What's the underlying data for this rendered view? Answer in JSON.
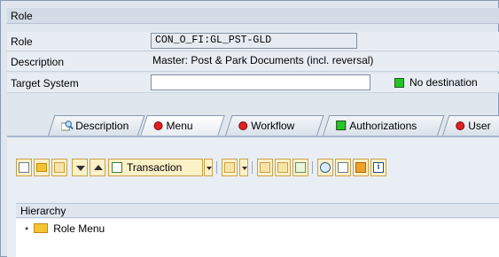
{
  "header": {
    "title": "Role"
  },
  "form": {
    "role": {
      "label": "Role",
      "value": "CON_O_FI:GL_PST-GLD"
    },
    "description": {
      "label": "Description",
      "value": "Master: Post & Park Documents (incl. reversal)"
    },
    "target_system": {
      "label": "Target System",
      "value": "",
      "status_text": "No destination",
      "status_color": "#27c327"
    }
  },
  "tabs": [
    {
      "label": "Description",
      "icon": "magnifier-icon"
    },
    {
      "label": "Menu",
      "icon": "red-status-icon",
      "active": true
    },
    {
      "label": "Workflow",
      "icon": "red-status-icon"
    },
    {
      "label": "Authorizations",
      "icon": "green-status-icon"
    },
    {
      "label": "User",
      "icon": "red-status-icon"
    }
  ],
  "toolbar": {
    "transaction_label": "Transaction"
  },
  "hierarchy": {
    "header": "Hierarchy",
    "items": [
      {
        "label": "Role Menu",
        "icon": "folder-icon"
      }
    ]
  },
  "colors": {
    "accent": "#27c327",
    "alert": "#e02020",
    "folder": "#f6c433"
  }
}
